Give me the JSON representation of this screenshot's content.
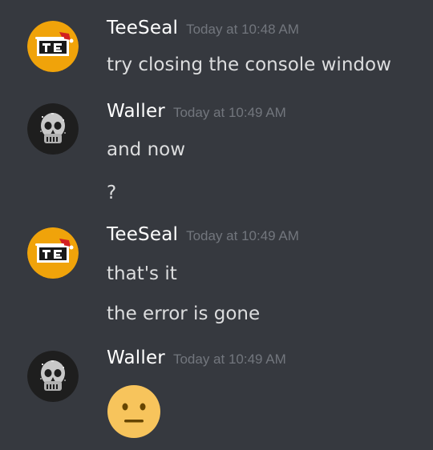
{
  "colors": {
    "background": "#36393f",
    "username": "#ffffff",
    "message_text": "#dcddde",
    "timestamp": "#72767d",
    "teeseal_avatar_bg": "#f0a30a",
    "waller_avatar_bg": "#1e1e1e"
  },
  "messages": [
    {
      "username": "TeeSeal",
      "timestamp": "Today at 10:48 AM",
      "avatar": "teeseal-logo-avatar",
      "lines": [
        "try closing the console window"
      ]
    },
    {
      "username": "Waller",
      "timestamp": "Today at 10:49 AM",
      "avatar": "skull-avatar",
      "lines": [
        "and now",
        "?"
      ]
    },
    {
      "username": "TeeSeal",
      "timestamp": "Today at 10:49 AM",
      "avatar": "teeseal-logo-avatar",
      "lines": [
        "that's it",
        "the error is gone"
      ]
    },
    {
      "username": "Waller",
      "timestamp": "Today at 10:49 AM",
      "avatar": "skull-avatar",
      "emoji": "neutral-face-icon"
    }
  ]
}
